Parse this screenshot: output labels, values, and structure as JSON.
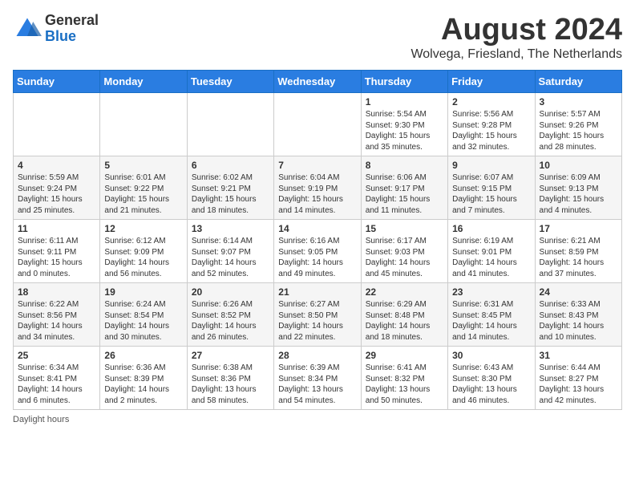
{
  "header": {
    "logo_general": "General",
    "logo_blue": "Blue",
    "main_title": "August 2024",
    "subtitle": "Wolvega, Friesland, The Netherlands"
  },
  "days_of_week": [
    "Sunday",
    "Monday",
    "Tuesday",
    "Wednesday",
    "Thursday",
    "Friday",
    "Saturday"
  ],
  "weeks": [
    [
      {
        "day": "",
        "info": ""
      },
      {
        "day": "",
        "info": ""
      },
      {
        "day": "",
        "info": ""
      },
      {
        "day": "",
        "info": ""
      },
      {
        "day": "1",
        "info": "Sunrise: 5:54 AM\nSunset: 9:30 PM\nDaylight: 15 hours\nand 35 minutes."
      },
      {
        "day": "2",
        "info": "Sunrise: 5:56 AM\nSunset: 9:28 PM\nDaylight: 15 hours\nand 32 minutes."
      },
      {
        "day": "3",
        "info": "Sunrise: 5:57 AM\nSunset: 9:26 PM\nDaylight: 15 hours\nand 28 minutes."
      }
    ],
    [
      {
        "day": "4",
        "info": "Sunrise: 5:59 AM\nSunset: 9:24 PM\nDaylight: 15 hours\nand 25 minutes."
      },
      {
        "day": "5",
        "info": "Sunrise: 6:01 AM\nSunset: 9:22 PM\nDaylight: 15 hours\nand 21 minutes."
      },
      {
        "day": "6",
        "info": "Sunrise: 6:02 AM\nSunset: 9:21 PM\nDaylight: 15 hours\nand 18 minutes."
      },
      {
        "day": "7",
        "info": "Sunrise: 6:04 AM\nSunset: 9:19 PM\nDaylight: 15 hours\nand 14 minutes."
      },
      {
        "day": "8",
        "info": "Sunrise: 6:06 AM\nSunset: 9:17 PM\nDaylight: 15 hours\nand 11 minutes."
      },
      {
        "day": "9",
        "info": "Sunrise: 6:07 AM\nSunset: 9:15 PM\nDaylight: 15 hours\nand 7 minutes."
      },
      {
        "day": "10",
        "info": "Sunrise: 6:09 AM\nSunset: 9:13 PM\nDaylight: 15 hours\nand 4 minutes."
      }
    ],
    [
      {
        "day": "11",
        "info": "Sunrise: 6:11 AM\nSunset: 9:11 PM\nDaylight: 15 hours\nand 0 minutes."
      },
      {
        "day": "12",
        "info": "Sunrise: 6:12 AM\nSunset: 9:09 PM\nDaylight: 14 hours\nand 56 minutes."
      },
      {
        "day": "13",
        "info": "Sunrise: 6:14 AM\nSunset: 9:07 PM\nDaylight: 14 hours\nand 52 minutes."
      },
      {
        "day": "14",
        "info": "Sunrise: 6:16 AM\nSunset: 9:05 PM\nDaylight: 14 hours\nand 49 minutes."
      },
      {
        "day": "15",
        "info": "Sunrise: 6:17 AM\nSunset: 9:03 PM\nDaylight: 14 hours\nand 45 minutes."
      },
      {
        "day": "16",
        "info": "Sunrise: 6:19 AM\nSunset: 9:01 PM\nDaylight: 14 hours\nand 41 minutes."
      },
      {
        "day": "17",
        "info": "Sunrise: 6:21 AM\nSunset: 8:59 PM\nDaylight: 14 hours\nand 37 minutes."
      }
    ],
    [
      {
        "day": "18",
        "info": "Sunrise: 6:22 AM\nSunset: 8:56 PM\nDaylight: 14 hours\nand 34 minutes."
      },
      {
        "day": "19",
        "info": "Sunrise: 6:24 AM\nSunset: 8:54 PM\nDaylight: 14 hours\nand 30 minutes."
      },
      {
        "day": "20",
        "info": "Sunrise: 6:26 AM\nSunset: 8:52 PM\nDaylight: 14 hours\nand 26 minutes."
      },
      {
        "day": "21",
        "info": "Sunrise: 6:27 AM\nSunset: 8:50 PM\nDaylight: 14 hours\nand 22 minutes."
      },
      {
        "day": "22",
        "info": "Sunrise: 6:29 AM\nSunset: 8:48 PM\nDaylight: 14 hours\nand 18 minutes."
      },
      {
        "day": "23",
        "info": "Sunrise: 6:31 AM\nSunset: 8:45 PM\nDaylight: 14 hours\nand 14 minutes."
      },
      {
        "day": "24",
        "info": "Sunrise: 6:33 AM\nSunset: 8:43 PM\nDaylight: 14 hours\nand 10 minutes."
      }
    ],
    [
      {
        "day": "25",
        "info": "Sunrise: 6:34 AM\nSunset: 8:41 PM\nDaylight: 14 hours\nand 6 minutes."
      },
      {
        "day": "26",
        "info": "Sunrise: 6:36 AM\nSunset: 8:39 PM\nDaylight: 14 hours\nand 2 minutes."
      },
      {
        "day": "27",
        "info": "Sunrise: 6:38 AM\nSunset: 8:36 PM\nDaylight: 13 hours\nand 58 minutes."
      },
      {
        "day": "28",
        "info": "Sunrise: 6:39 AM\nSunset: 8:34 PM\nDaylight: 13 hours\nand 54 minutes."
      },
      {
        "day": "29",
        "info": "Sunrise: 6:41 AM\nSunset: 8:32 PM\nDaylight: 13 hours\nand 50 minutes."
      },
      {
        "day": "30",
        "info": "Sunrise: 6:43 AM\nSunset: 8:30 PM\nDaylight: 13 hours\nand 46 minutes."
      },
      {
        "day": "31",
        "info": "Sunrise: 6:44 AM\nSunset: 8:27 PM\nDaylight: 13 hours\nand 42 minutes."
      }
    ]
  ],
  "footer": {
    "daylight_label": "Daylight hours"
  }
}
